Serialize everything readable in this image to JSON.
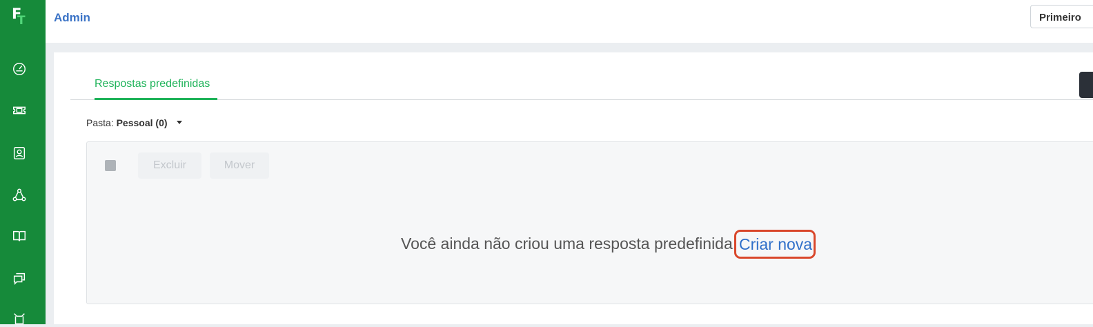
{
  "logo": {
    "letter_f": "F",
    "letter_t": "T"
  },
  "sidebar": {
    "icons": [
      {
        "name": "dashboard-icon"
      },
      {
        "name": "tickets-icon"
      },
      {
        "name": "contacts-icon"
      },
      {
        "name": "groups-icon"
      },
      {
        "name": "knowledge-base-icon"
      },
      {
        "name": "chat-icon"
      },
      {
        "name": "more-icon"
      }
    ]
  },
  "header": {
    "title": "Admin",
    "user_button": "Primeiro"
  },
  "tabs": [
    {
      "label": "Respostas predefinidas",
      "active": true
    }
  ],
  "folder": {
    "label": "Pasta:",
    "value": "Pessoal (0)"
  },
  "toolbar": {
    "delete_label": "Excluir",
    "move_label": "Mover"
  },
  "empty_state": {
    "message": "Você ainda não criou uma resposta predefinida.",
    "link": "Criar nova"
  },
  "colors": {
    "sidebar": "#168a3a",
    "accent_green": "#1fb35a",
    "link_blue": "#2f6fc9",
    "highlight": "#d9472b"
  }
}
